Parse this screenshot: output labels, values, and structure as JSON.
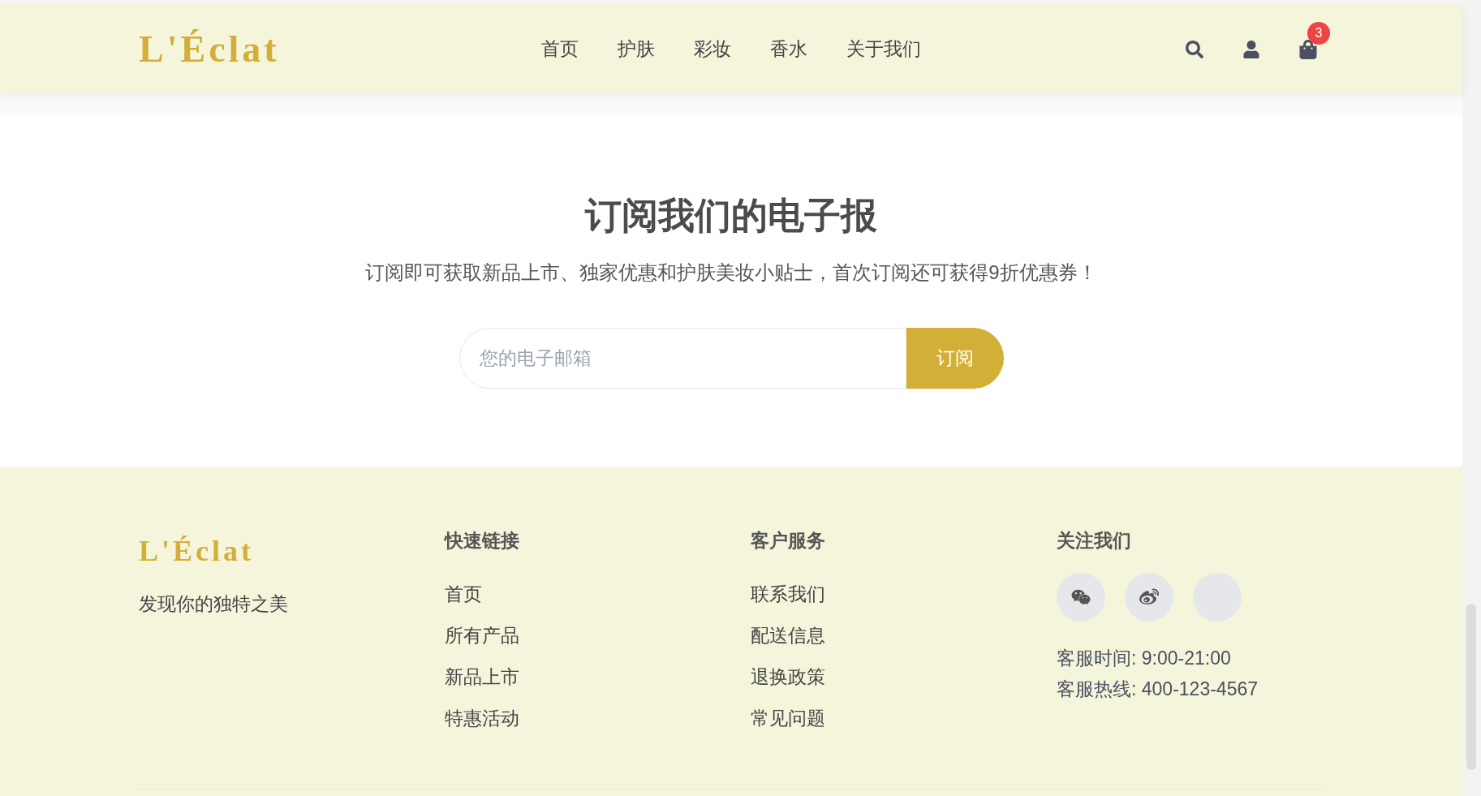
{
  "header": {
    "logo": "L'Éclat",
    "nav": [
      {
        "label": "首页"
      },
      {
        "label": "护肤"
      },
      {
        "label": "彩妆"
      },
      {
        "label": "香水"
      },
      {
        "label": "关于我们"
      }
    ],
    "cart_count": "3"
  },
  "newsletter": {
    "title": "订阅我们的电子报",
    "subtitle": "订阅即可获取新品上市、独家优惠和护肤美妆小贴士，首次订阅还可获得9折优惠券！",
    "email": {
      "placeholder": "您的电子邮箱"
    },
    "button": "订阅"
  },
  "footer": {
    "logo": "L'Éclat",
    "tagline": "发现你的独特之美",
    "columns": [
      {
        "heading": "快速链接",
        "links": [
          "首页",
          "所有产品",
          "新品上市",
          "特惠活动"
        ]
      },
      {
        "heading": "客户服务",
        "links": [
          "联系我们",
          "配送信息",
          "退换政策",
          "常见问题"
        ]
      }
    ],
    "follow": {
      "heading": "关注我们",
      "social": [
        {
          "kind": "wechat"
        },
        {
          "kind": "weibo"
        },
        {
          "kind": "blank"
        }
      ],
      "info": [
        "客服时间: 9:00-21:00",
        "客服热线: 400-123-4567"
      ]
    }
  }
}
